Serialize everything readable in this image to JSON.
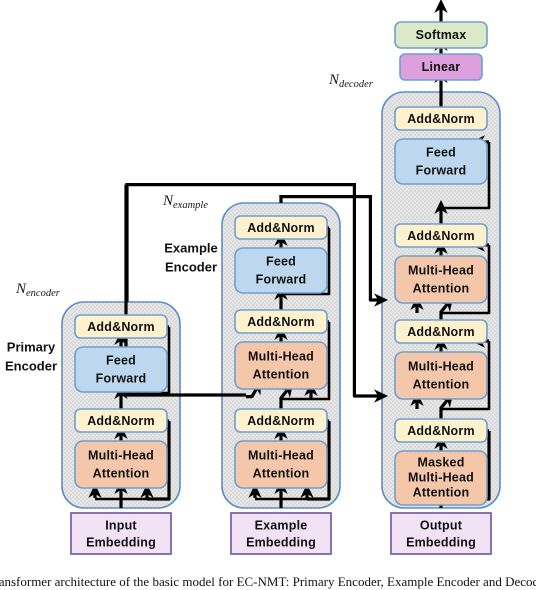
{
  "figure": {
    "title": "Transformer architecture of the basic model for EC-NMT: Primary Encoder, Example Encoder and Decoder",
    "background_color": "#ffffff"
  },
  "colors": {
    "addnorm_fill": "#fdf2cd",
    "addnorm_stroke": "#6f9fd0",
    "feedforward_fill": "#bdd7ee",
    "feedforward_stroke": "#6f9fd0",
    "attention_fill": "#f4c7ab",
    "attention_stroke": "#6f9fd0",
    "embedding_fill": "#f2e2f5",
    "embedding_stroke": "#8064a2",
    "linear_fill": "#dda0dd",
    "linear_stroke": "#6f9fd0",
    "softmax_fill": "#dbe9c8",
    "softmax_stroke": "#6f9fd0",
    "stack_fill": "#e3e3e3",
    "stack_stroke": "#5b8fc4",
    "arrow_color": "#000000"
  },
  "stacks": [
    {
      "id": "primary-encoder",
      "name_line1": "Primary",
      "name_line2": "Encoder",
      "repeat_label_base": "N",
      "repeat_label_sub": "encoder"
    },
    {
      "id": "example-encoder",
      "name_line1": "Example",
      "name_line2": "Encoder",
      "repeat_label_base": "N",
      "repeat_label_sub": "example"
    },
    {
      "id": "decoder",
      "name_line1": "",
      "name_line2": "",
      "repeat_label_base": "N",
      "repeat_label_sub": "decoder"
    }
  ],
  "blocks": {
    "primary_encoder": [
      {
        "id": "pe-addnorm-2",
        "label": "Add&Norm",
        "type": "addnorm"
      },
      {
        "id": "pe-ff",
        "label_line1": "Feed",
        "label_line2": "Forward",
        "type": "feedforward"
      },
      {
        "id": "pe-addnorm-1",
        "label": "Add&Norm",
        "type": "addnorm"
      },
      {
        "id": "pe-mha",
        "label_line1": "Multi-Head",
        "label_line2": "Attention",
        "type": "attention"
      }
    ],
    "example_encoder": [
      {
        "id": "ee-addnorm-3",
        "label": "Add&Norm",
        "type": "addnorm"
      },
      {
        "id": "ee-ff",
        "label_line1": "Feed",
        "label_line2": "Forward",
        "type": "feedforward"
      },
      {
        "id": "ee-addnorm-2",
        "label": "Add&Norm",
        "type": "addnorm"
      },
      {
        "id": "ee-mha-2",
        "label_line1": "Multi-Head",
        "label_line2": "Attention",
        "type": "attention"
      },
      {
        "id": "ee-addnorm-1",
        "label": "Add&Norm",
        "type": "addnorm"
      },
      {
        "id": "ee-mha-1",
        "label_line1": "Multi-Head",
        "label_line2": "Attention",
        "type": "attention"
      }
    ],
    "decoder": [
      {
        "id": "dec-addnorm-3",
        "label": "Add&Norm",
        "type": "addnorm"
      },
      {
        "id": "dec-ff",
        "label_line1": "Feed",
        "label_line2": "Forward",
        "type": "feedforward"
      },
      {
        "id": "dec-addnorm-2",
        "label": "Add&Norm",
        "type": "addnorm"
      },
      {
        "id": "dec-mha-2",
        "label_line1": "Multi-Head",
        "label_line2": "Attention",
        "type": "attention"
      },
      {
        "id": "dec-addnorm-1b",
        "label": "Add&Norm",
        "type": "addnorm"
      },
      {
        "id": "dec-mha-1",
        "label_line1": "Multi-Head",
        "label_line2": "Attention",
        "type": "attention"
      },
      {
        "id": "dec-addnorm-1",
        "label": "Add&Norm",
        "type": "addnorm"
      },
      {
        "id": "dec-masked-mha",
        "label_line1": "Masked",
        "label_line2": "Multi-Head",
        "label_line3": "Attention",
        "type": "attention"
      }
    ]
  },
  "embeddings": [
    {
      "id": "input-embedding",
      "label_line1": "Input",
      "label_line2": "Embedding"
    },
    {
      "id": "example-embedding",
      "label_line1": "Example",
      "label_line2": "Embedding"
    },
    {
      "id": "output-embedding",
      "label_line1": "Output",
      "label_line2": "Embedding"
    }
  ],
  "head": [
    {
      "id": "linear",
      "label": "Linear"
    },
    {
      "id": "softmax",
      "label": "Softmax"
    }
  ]
}
